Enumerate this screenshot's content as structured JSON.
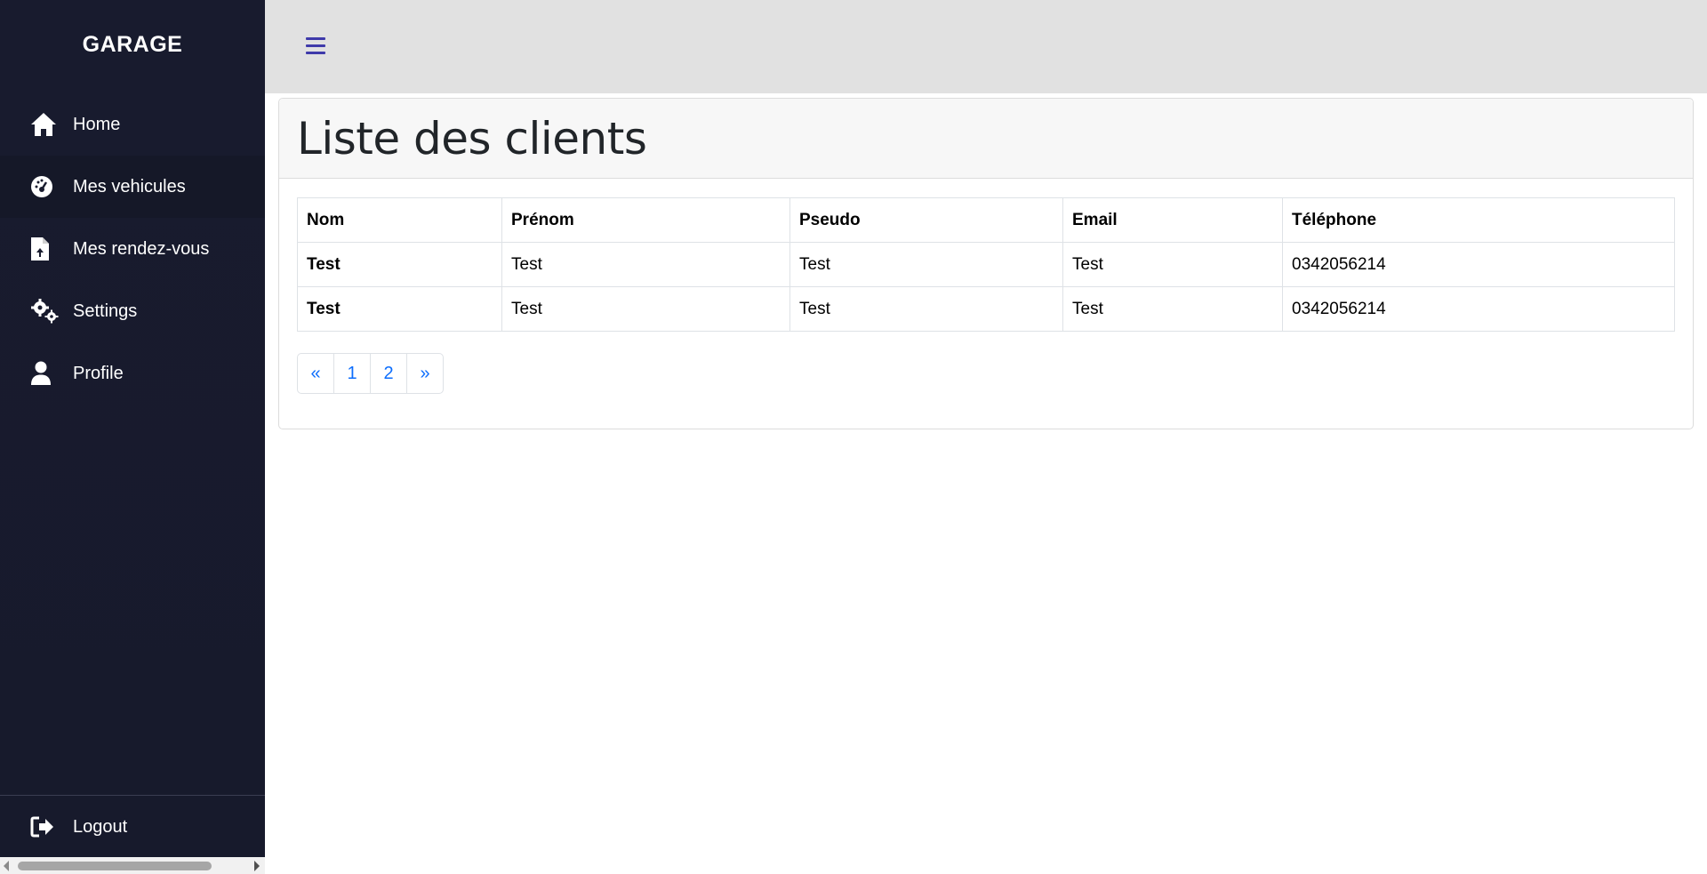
{
  "app": {
    "brand": "GARAGE"
  },
  "sidebar": {
    "items": [
      {
        "label": "Home",
        "icon": "home-icon"
      },
      {
        "label": "Mes vehicules",
        "icon": "dashboard-gauge-icon"
      },
      {
        "label": "Mes rendez-vous",
        "icon": "file-upload-icon"
      },
      {
        "label": "Settings",
        "icon": "gears-icon"
      },
      {
        "label": "Profile",
        "icon": "user-icon"
      }
    ],
    "logout": {
      "label": "Logout",
      "icon": "sign-out-icon"
    }
  },
  "topbar": {
    "menu_icon": "hamburger-icon",
    "accent": "#3f3aaa"
  },
  "main": {
    "title": "Liste des clients",
    "table": {
      "headers": [
        "Nom",
        "Prénom",
        "Pseudo",
        "Email",
        "Téléphone"
      ],
      "rows": [
        [
          "Test",
          "Test",
          "Test",
          "Test",
          "0342056214"
        ],
        [
          "Test",
          "Test",
          "Test",
          "Test",
          "0342056214"
        ]
      ]
    },
    "pagination": {
      "prev": "«",
      "pages": [
        "1",
        "2"
      ],
      "next": "»"
    }
  },
  "colors": {
    "sidebar_bg": "#181b2e",
    "topbar_bg": "#e1e1e1",
    "link": "#0d6efd"
  }
}
